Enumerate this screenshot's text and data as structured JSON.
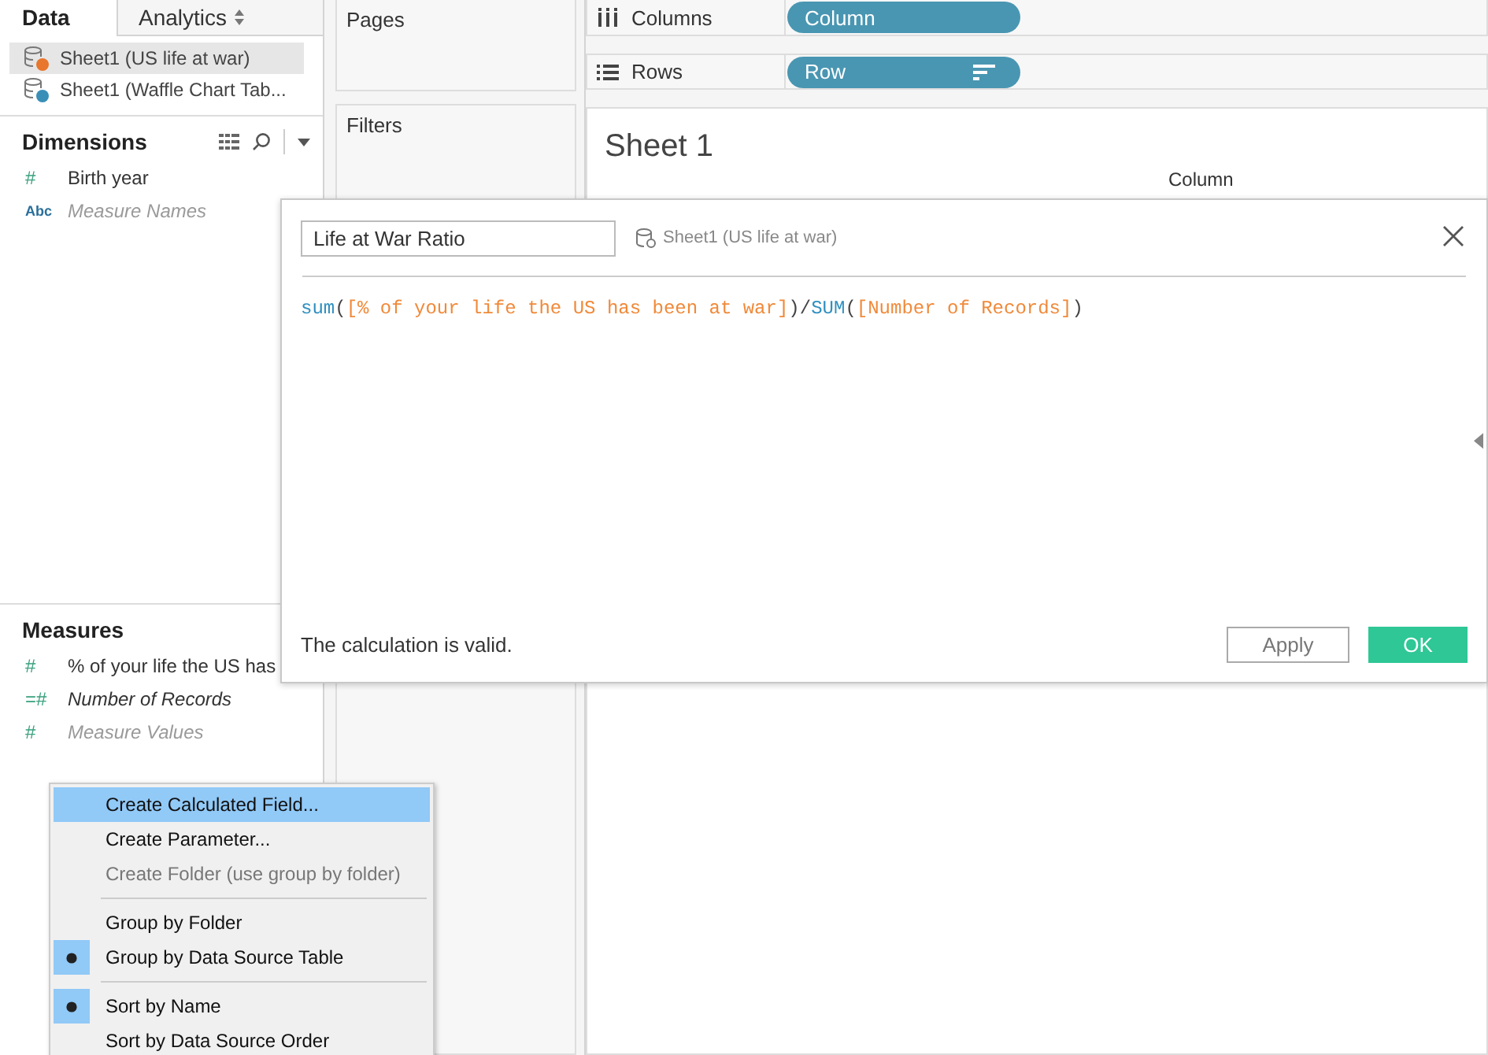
{
  "side_tabs": [
    {
      "label": "Data",
      "selected": true
    },
    {
      "label": "Analytics",
      "selected": false
    }
  ],
  "data_sources": [
    {
      "label": "Sheet1 (US life at war)",
      "selected": true,
      "color": "#e8762d"
    },
    {
      "label": "Sheet1 (Waffle Chart Tab...",
      "selected": false,
      "color": "#3a8fb7"
    }
  ],
  "dimensions": {
    "title": "Dimensions",
    "fields": [
      {
        "icon": "#",
        "label": "Birth year",
        "kind": "normal"
      },
      {
        "icon": "Abc",
        "label": "Measure Names",
        "kind": "generated"
      }
    ]
  },
  "measures": {
    "title": "Measures",
    "fields": [
      {
        "icon": "#",
        "label": "% of your life the US has",
        "kind": "normal"
      },
      {
        "icon": "=#",
        "label": "Number of Records",
        "kind": "calculated"
      },
      {
        "icon": "#",
        "label": "Measure Values",
        "kind": "generated"
      }
    ]
  },
  "cards": [
    {
      "title": "Pages"
    },
    {
      "title": "Filters"
    }
  ],
  "shelves": [
    {
      "kind": "columns",
      "label": "Columns",
      "pill": "Column"
    },
    {
      "kind": "rows",
      "label": "Rows",
      "pill": "Row"
    }
  ],
  "sheet": {
    "title": "Sheet 1",
    "column_header": "Column"
  },
  "calc_dialog": {
    "name": "Life at War Ratio",
    "source": "Sheet1 (US life at war)",
    "formula": [
      {
        "kind": "function",
        "text": "sum"
      },
      {
        "kind": "operator",
        "text": "("
      },
      {
        "kind": "field",
        "text": "[% of your life the US has been at war]"
      },
      {
        "kind": "operator",
        "text": ")/"
      },
      {
        "kind": "function",
        "text": "SUM"
      },
      {
        "kind": "operator",
        "text": "("
      },
      {
        "kind": "field",
        "text": "[Number of Records]"
      },
      {
        "kind": "operator",
        "text": ")"
      }
    ],
    "status": "The calculation is valid.",
    "buttons": [
      {
        "label": "Apply",
        "kind": "secondary"
      },
      {
        "label": "OK",
        "kind": "primary"
      }
    ]
  },
  "context_menu": {
    "groups": [
      [
        {
          "label": "Create Calculated Field...",
          "selected": true,
          "disabled": false,
          "checked": false
        },
        {
          "label": "Create Parameter...",
          "selected": false,
          "disabled": false,
          "checked": false
        },
        {
          "label": "Create Folder (use group by folder)",
          "selected": false,
          "disabled": true,
          "checked": false
        }
      ],
      [
        {
          "label": "Group by Folder",
          "selected": false,
          "disabled": false,
          "checked": false
        },
        {
          "label": "Group by Data Source Table",
          "selected": false,
          "disabled": false,
          "checked": true
        }
      ],
      [
        {
          "label": "Sort by Name",
          "selected": false,
          "disabled": false,
          "checked": true
        },
        {
          "label": "Sort by Data Source Order",
          "selected": false,
          "disabled": false,
          "checked": false
        }
      ]
    ]
  }
}
